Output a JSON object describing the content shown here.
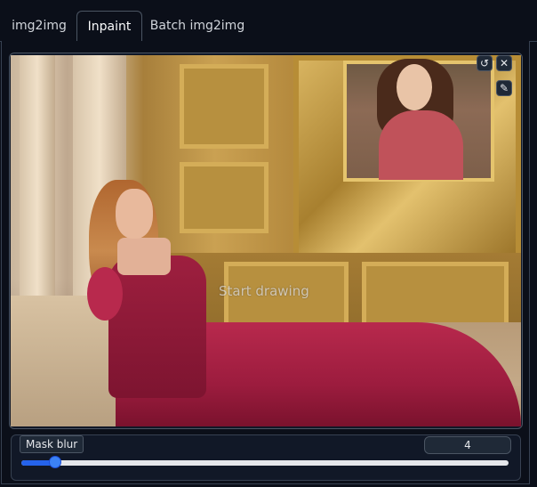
{
  "tabs": [
    {
      "label": "img2img",
      "active": false
    },
    {
      "label": "Inpaint",
      "active": true
    },
    {
      "label": "Batch img2img",
      "active": false
    }
  ],
  "canvas": {
    "overlay_text": "Start drawing",
    "icons": [
      "undo-icon",
      "close-icon",
      "brush-icon"
    ]
  },
  "mask_blur": {
    "label": "Mask blur",
    "value": "4",
    "fraction": 0.07
  },
  "colors": {
    "background": "#0b0f19",
    "accent": "#3b82f6"
  }
}
